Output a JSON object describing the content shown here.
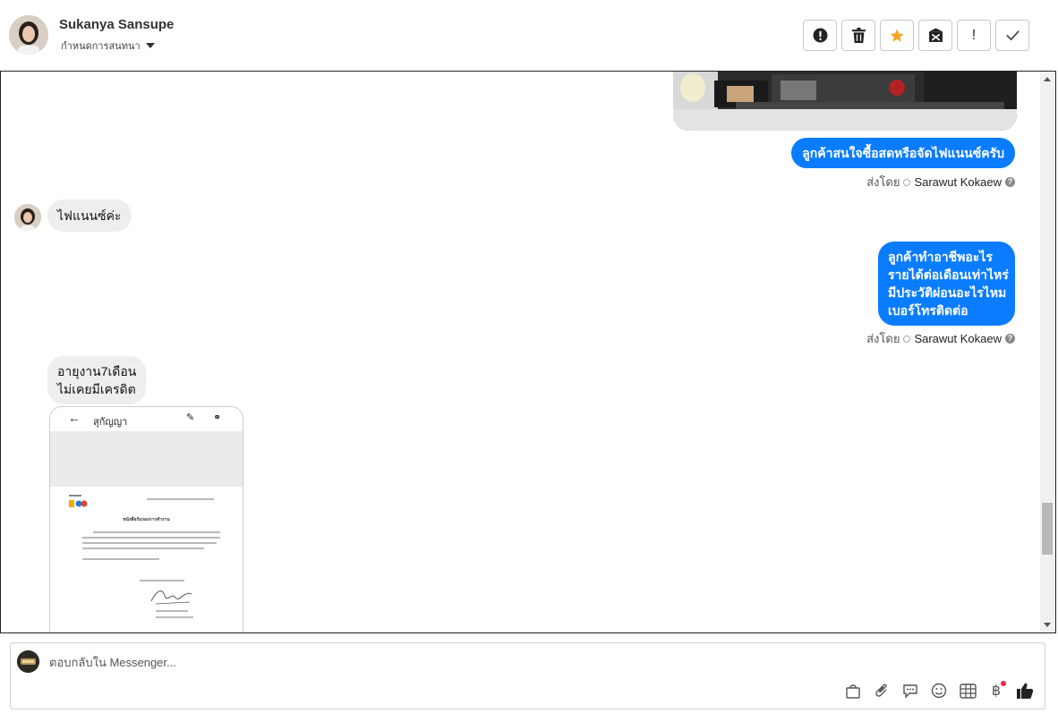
{
  "header": {
    "name": "Sukanya Sansupe",
    "assign_label": "กำหนดการสนทนา"
  },
  "toolbar": {
    "buttons": [
      {
        "name": "report-spam-button",
        "icon": "alert-circle-icon"
      },
      {
        "name": "delete-button",
        "icon": "trash-icon"
      },
      {
        "name": "star-button",
        "icon": "star-icon",
        "color": "#f5a623"
      },
      {
        "name": "mark-unread-button",
        "icon": "envelope-x-icon"
      },
      {
        "name": "important-button",
        "icon": "exclamation-icon",
        "label": "!"
      },
      {
        "name": "done-button",
        "icon": "checkmark-icon"
      }
    ]
  },
  "messages": {
    "out_1": "ลูกค้าสนใจซื้อสดหรือจัดไฟแนนซ์ครับ",
    "in_1": "ไฟแนนซ์ค่ะ",
    "out_2": [
      "ลูกค้าทำอาชีพอะไร",
      "รายได้ต่อเดือนเท่าไหร่",
      "มีประวัติผ่อนอะไรไหม",
      "เบอร์โทรติดต่อ"
    ],
    "in_2": [
      "อายุงาน7เดือน",
      "ไม่เคยมีเครดิต"
    ],
    "sent_by_label": "ส่งโดย",
    "sent_by_name": "Sarawut Kokaew",
    "attachment": {
      "title": "สุกัญญา",
      "doc_heading": "หนังสือรับรองการทำงาน"
    }
  },
  "composer": {
    "placeholder": "ตอบกลับใน Messenger...",
    "tools": [
      "shopping-bag-icon",
      "paperclip-icon",
      "chat-bubble-icon",
      "emoji-icon",
      "table-icon",
      "baht-icon",
      "thumbs-up-icon"
    ]
  },
  "colors": {
    "outgoing_bubble": "#0a7cff",
    "incoming_bubble": "#eeeeee",
    "star": "#f5a623",
    "notification_dot": "#f02849"
  }
}
